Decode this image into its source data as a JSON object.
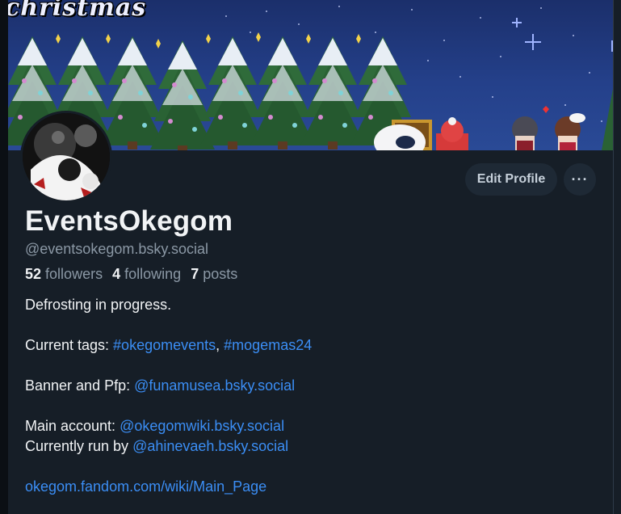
{
  "banner": {
    "title_text": "christmas"
  },
  "profile": {
    "display_name": "EventsOkegom",
    "handle": "@eventsokegom.bsky.social",
    "edit_label": "Edit Profile",
    "more_label": "···"
  },
  "stats": {
    "followers_count": "52",
    "followers_label": "followers",
    "following_count": "4",
    "following_label": "following",
    "posts_count": "7",
    "posts_label": "posts"
  },
  "bio": {
    "line1": "Defrosting in progress.",
    "tags_label": "Current tags: ",
    "tag1": "#okegomevents",
    "tag_sep": ", ",
    "tag2": "#mogemas24",
    "banner_label": "Banner and Pfp: ",
    "banner_link": "@funamusea.bsky.social",
    "main_label": "Main account: ",
    "main_link": "@okegomwiki.bsky.social",
    "run_label": "Currently run by ",
    "run_link": "@ahinevaeh.bsky.social",
    "wiki_link": "okegom.fandom.com/wiki/Main_Page"
  },
  "colors": {
    "background": "#161e27",
    "link": "#3b8ef5",
    "muted": "#8b98a5",
    "button_bg": "#1e2935"
  }
}
